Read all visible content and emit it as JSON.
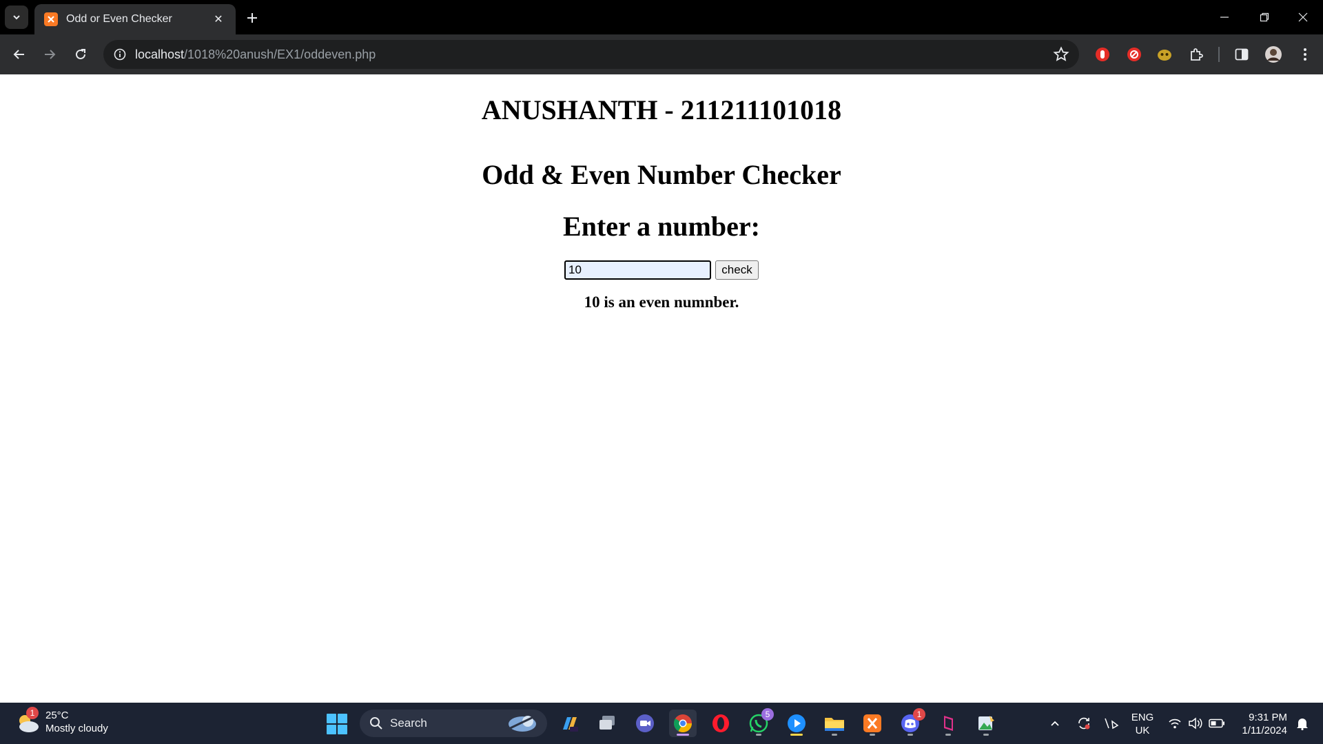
{
  "browser": {
    "tab_title": "Odd or Even Checker",
    "url_host": "localhost",
    "url_path": "/1018%20anush/EX1/oddeven.php"
  },
  "page": {
    "name_heading": "ANUSHANTH - 211211101018",
    "title": "Odd & Even Number Checker",
    "prompt": "Enter a number:",
    "input_value": "10",
    "button_label": "check",
    "result": "10 is an even numnber."
  },
  "taskbar": {
    "weather_badge": "1",
    "temperature": "25°C",
    "condition": "Mostly cloudy",
    "search_label": "Search",
    "whatsapp_badge": "5",
    "discord_badge": "1",
    "lang_primary": "ENG",
    "lang_secondary": "UK",
    "time": "9:31 PM",
    "date": "1/11/2024"
  }
}
